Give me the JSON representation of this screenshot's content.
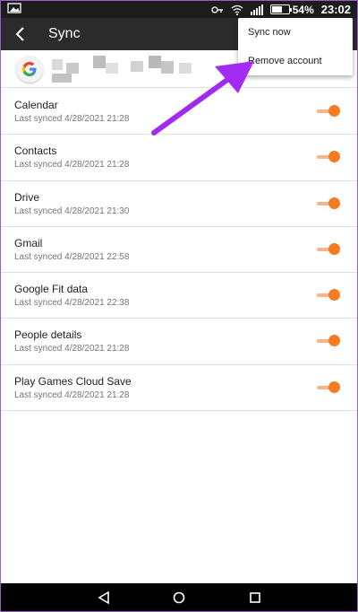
{
  "status_bar": {
    "battery_percent": "54%",
    "time": "23:02",
    "icons": [
      "key-icon",
      "wifi-icon",
      "signal-icon",
      "battery-icon"
    ]
  },
  "app_bar": {
    "title": "Sync",
    "back_icon": "back-arrow-icon"
  },
  "account": {
    "logo": "google-logo-icon"
  },
  "menu": {
    "items": [
      "Sync now",
      "Remove account"
    ]
  },
  "sync_items": [
    {
      "title": "Calendar",
      "subtitle": "Last synced 4/28/2021 21:28",
      "enabled": true
    },
    {
      "title": "Contacts",
      "subtitle": "Last synced 4/28/2021 21:28",
      "enabled": true
    },
    {
      "title": "Drive",
      "subtitle": "Last synced 4/28/2021 21:30",
      "enabled": true
    },
    {
      "title": "Gmail",
      "subtitle": "Last synced 4/28/2021 22:58",
      "enabled": true
    },
    {
      "title": "Google Fit data",
      "subtitle": "Last synced 4/28/2021 22:38",
      "enabled": true
    },
    {
      "title": "People details",
      "subtitle": "Last synced 4/28/2021 21:28",
      "enabled": true
    },
    {
      "title": "Play Games Cloud Save",
      "subtitle": "Last synced 4/28/2021 21:28",
      "enabled": true
    }
  ],
  "nav_bar": {
    "icons": [
      "back-triangle-icon",
      "home-circle-icon",
      "recents-square-icon"
    ]
  },
  "colors": {
    "accent": "#f57c22",
    "app_bar": "#2b2b2b",
    "annotation_arrow": "#a12bf0"
  }
}
